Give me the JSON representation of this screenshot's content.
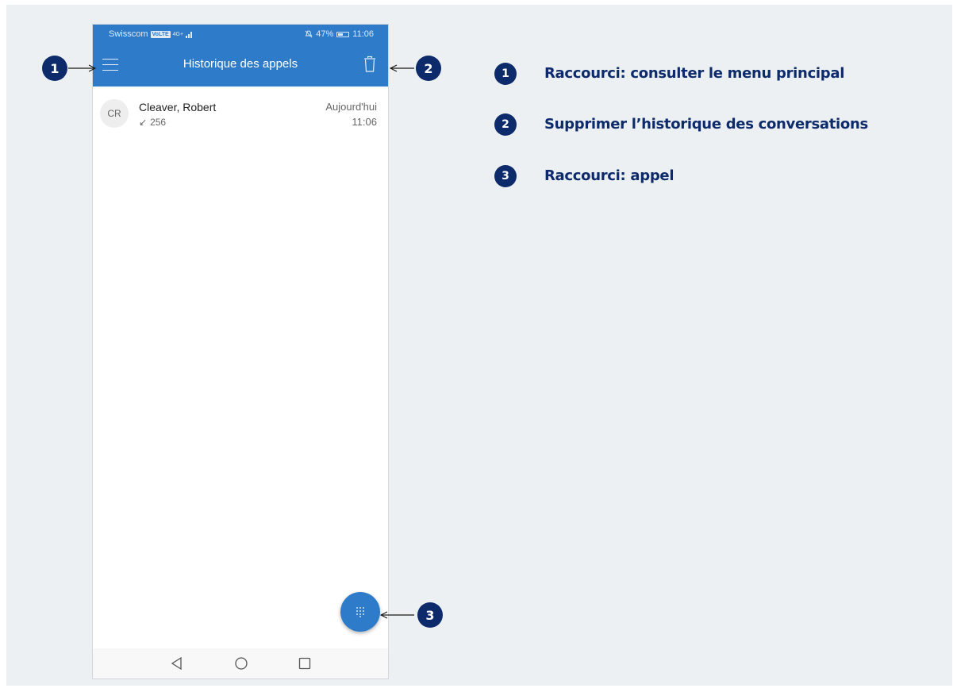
{
  "status_bar": {
    "carrier": "Swisscom",
    "volte": "VoLTE",
    "network": "4G+",
    "battery_percent": "47%",
    "time": "11:06"
  },
  "app_bar": {
    "title": "Historique des appels",
    "menu_icon": "hamburger-menu-icon",
    "delete_icon": "trash-icon"
  },
  "call_history": [
    {
      "initials": "CR",
      "name": "Cleaver, Robert",
      "direction_icon": "incoming-call-arrow-icon",
      "number": "256",
      "date": "Aujourd'hui",
      "time": "11:06"
    }
  ],
  "fab": {
    "icon": "dialpad-icon"
  },
  "nav_bar": {
    "icons": [
      "back-icon",
      "home-icon",
      "recent-apps-icon"
    ]
  },
  "callouts": [
    {
      "number": "1",
      "text": "Raccourci: consulter le menu principal"
    },
    {
      "number": "2",
      "text": "Supprimer l’historique des conversations"
    },
    {
      "number": "3",
      "text": "Raccourci: appel"
    }
  ],
  "colors": {
    "app_blue": "#2e7cc9",
    "callout_navy": "#0d2b6b",
    "background": "#edf0f2"
  }
}
